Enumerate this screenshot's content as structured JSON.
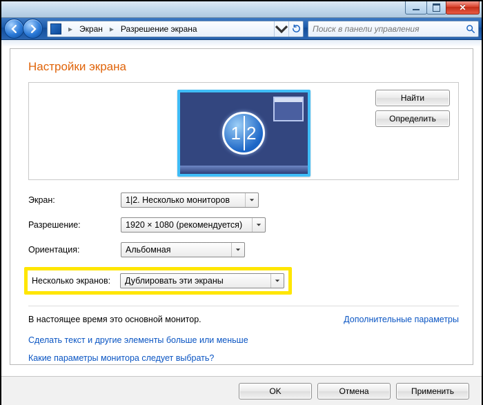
{
  "titlebar": {
    "minimize": "minimize",
    "maximize": "maximize",
    "close": "close"
  },
  "breadcrumb": {
    "seg1": "Экран",
    "seg2": "Разрешение экрана"
  },
  "search": {
    "placeholder": "Поиск в панели управления"
  },
  "heading": "Настройки экрана",
  "preview": {
    "id1": "1",
    "id2": "2",
    "find": "Найти",
    "detect": "Определить"
  },
  "rows": {
    "display": {
      "label": "Экран:",
      "value": "1|2. Несколько мониторов"
    },
    "resolution": {
      "label": "Разрешение:",
      "value": "1920 × 1080 (рекомендуется)"
    },
    "orientation": {
      "label": "Ориентация:",
      "value": "Альбомная"
    },
    "multi": {
      "label": "Несколько экранов:",
      "value": "Дублировать эти экраны"
    }
  },
  "status": "В настоящее время это основной монитор.",
  "advanced": "Дополнительные параметры",
  "links": {
    "scale": "Сделать текст и другие элементы больше или меньше",
    "which": "Какие параметры монитора следует выбрать?"
  },
  "buttons": {
    "ok": "OK",
    "cancel": "Отмена",
    "apply": "Применить"
  }
}
